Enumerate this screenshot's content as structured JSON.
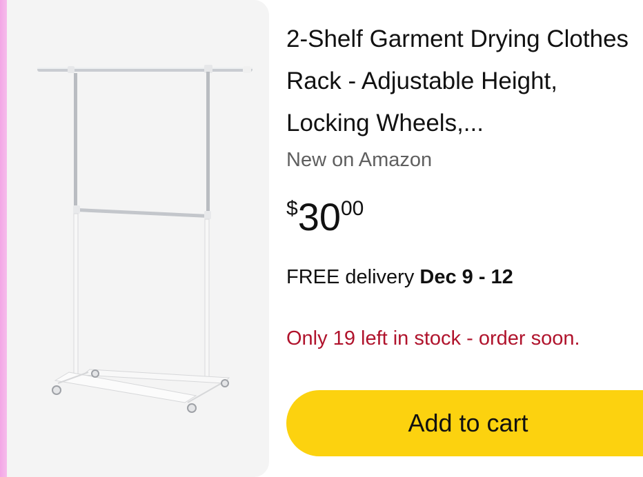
{
  "product": {
    "image_alt": "Two-shelf white garment rack with wheels",
    "title": "2-Shelf Garment Drying Clothes Rack - Adjustable Height, Locking Wheels,...",
    "seller_note": "New on Amazon",
    "price": {
      "currency": "$",
      "whole": "30",
      "fraction": "00"
    },
    "delivery": {
      "prefix": "FREE delivery ",
      "dates": "Dec 9 - 12"
    },
    "stock": "Only 19 left in stock - order soon.",
    "add_to_cart_label": "Add to cart"
  },
  "colors": {
    "button": "#fcd20f",
    "stock_warning": "#b0132c",
    "muted_text": "#5f5f5f",
    "image_background": "#f4f4f4"
  }
}
